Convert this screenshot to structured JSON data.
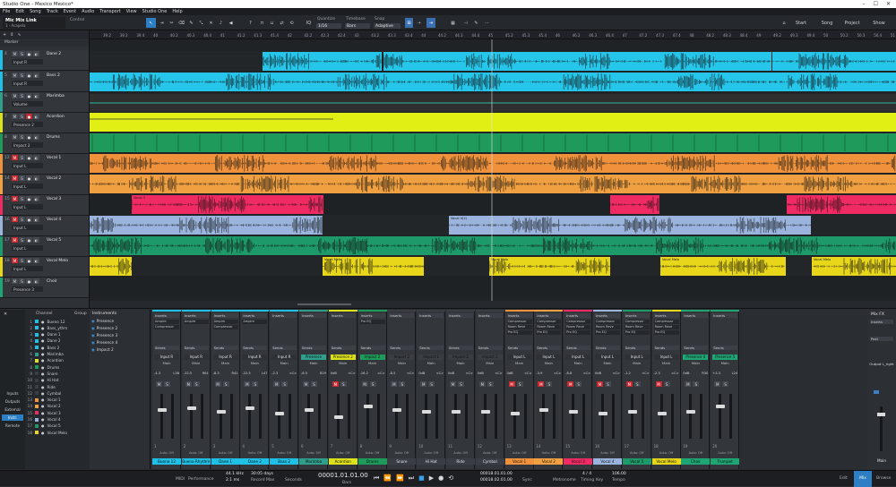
{
  "window": {
    "title": "Studio One - Mexico Mexico*"
  },
  "menu": [
    "File",
    "Edit",
    "Song",
    "Track",
    "Event",
    "Audio",
    "Transport",
    "View",
    "Studio One",
    "Help"
  ],
  "toolbar": {
    "song_name": "Mic Mix Link",
    "preset": "1 - Acapela",
    "control_label": "Control",
    "quantize_label": "Quantize",
    "quantize_value": "1/16",
    "timebase_label": "Timebase",
    "timebase_value": "Bars",
    "snap_label": "Snap",
    "snap_value": "Adaptive",
    "start": "Start",
    "song": "Song",
    "project": "Project",
    "show": "Show"
  },
  "ruler": {
    "marks": [
      "39.2",
      "39.3",
      "39.4",
      "40",
      "40.2",
      "40.3",
      "40.4",
      "41",
      "41.2",
      "41.3",
      "41.4",
      "42",
      "42.2",
      "42.3",
      "42.4",
      "43",
      "43.2",
      "43.3",
      "43.4",
      "44",
      "44.2",
      "44.3",
      "44.4",
      "45",
      "45.2",
      "45.3",
      "45.4",
      "46",
      "46.2",
      "46.3",
      "46.4",
      "47",
      "47.2",
      "47.3",
      "47.4",
      "48",
      "48.2",
      "48.3",
      "48.4",
      "49",
      "49.2",
      "49.3",
      "49.4",
      "50",
      "50.2",
      "50.3",
      "50.4",
      "51"
    ]
  },
  "tracks": [
    {
      "num": "4",
      "name": "Dane 2",
      "input": "Input R",
      "color": "#1ec0e6"
    },
    {
      "num": "5",
      "name": "Bass 2",
      "input": "Input R",
      "color": "#1ec0e6"
    },
    {
      "num": "6",
      "name": "Marimba",
      "input": "Volume",
      "color": "#2f9e8a",
      "value": "-2.5"
    },
    {
      "num": "7",
      "name": "Acordion",
      "input": "Presence 2",
      "color": "#dde11a"
    },
    {
      "num": "8",
      "name": "Drums",
      "input": "Impact 2",
      "color": "#1e9a5a"
    },
    {
      "num": "12",
      "name": "Vocal 1",
      "input": "Input L",
      "color": "#f0923c"
    },
    {
      "num": "14",
      "name": "Vocal 2",
      "input": "Input L",
      "color": "#f0a040"
    },
    {
      "num": "15",
      "name": "Vocal 3",
      "input": "Input L",
      "color": "#f02a62"
    },
    {
      "num": "16",
      "name": "Vocal 4",
      "input": "Input L",
      "color": "#9ab4de"
    },
    {
      "num": "17",
      "name": "Vocal 5",
      "input": "Input L",
      "color": "#1e9a6a"
    },
    {
      "num": "18",
      "name": "Vocal Melo",
      "input": "Input L",
      "color": "#e8d61a"
    },
    {
      "num": "19",
      "name": "Choir",
      "input": "Presence 3",
      "color": "#1ea574"
    }
  ],
  "clip_labels": {
    "vocal3": "Vocal 3",
    "vocal4": "Vocal 4(2)",
    "vocalmelo": "Vocal Melo"
  },
  "track_header_top": {
    "label": "Marker"
  },
  "instruments": {
    "header": "Instruments",
    "items": [
      "Presence",
      "Presence 2",
      "Presence 3",
      "Presence 4",
      "Impact 2"
    ]
  },
  "channel_list": {
    "header_channel": "Channel",
    "header_group": "Group",
    "items": [
      {
        "n": "1",
        "name": "Bueno 12"
      },
      {
        "n": "2",
        "name": "Bass_ythm"
      },
      {
        "n": "3",
        "name": "Dane 1"
      },
      {
        "n": "4",
        "name": "Dane 2"
      },
      {
        "n": "5",
        "name": "Bass 2"
      },
      {
        "n": "6",
        "name": "Marimba"
      },
      {
        "n": "7",
        "name": "Acordion"
      },
      {
        "n": "8",
        "name": "Drums"
      },
      {
        "n": "9",
        "name": "Snare"
      },
      {
        "n": "10",
        "name": "Hi Hat"
      },
      {
        "n": "11",
        "name": "Ride"
      },
      {
        "n": "12",
        "name": "Cymbal"
      },
      {
        "n": "13",
        "name": "Vocal 1"
      },
      {
        "n": "14",
        "name": "Vocal 2"
      },
      {
        "n": "15",
        "name": "Vocal 3"
      },
      {
        "n": "16",
        "name": "Vocal 4"
      },
      {
        "n": "17",
        "name": "Vocal 5"
      },
      {
        "n": "18",
        "name": "Vocal Melo"
      }
    ],
    "side": [
      "Inputs",
      "Outputs",
      "External",
      "Instr.",
      "Remote"
    ]
  },
  "strips": [
    {
      "n": "1",
      "label": "Bueno 12",
      "color": "#1ec0e6",
      "input": "Input R",
      "vals": [
        "-4.3",
        "L38"
      ]
    },
    {
      "n": "2",
      "label": "Bueno Rhythm",
      "color": "#1ec0e6",
      "input": "Input R",
      "vals": [
        "-22.5",
        "R61"
      ]
    },
    {
      "n": "3",
      "label": "Dane 1",
      "color": "#1ec0e6",
      "input": "Input R",
      "vals": [
        "-8.3",
        "R41"
      ]
    },
    {
      "n": "4",
      "label": "Dane 2",
      "color": "#1ec0e6",
      "input": "Input R",
      "vals": [
        "-22.5",
        "L47"
      ]
    },
    {
      "n": "5",
      "label": "Bass 2",
      "color": "#1ec0e6",
      "input": "Input R",
      "vals": [
        "-2.3",
        "<C>"
      ]
    },
    {
      "n": "6",
      "label": "Marimba",
      "color": "#2f9e8a",
      "input": "Presence",
      "vals": [
        "-8.5",
        "R29"
      ]
    },
    {
      "n": "7",
      "label": "Acordion",
      "color": "#dde11a",
      "input": "Presence 2",
      "vals": [
        "0dB",
        "<C>"
      ]
    },
    {
      "n": "8",
      "label": "Drums",
      "color": "#1e9a5a",
      "input": "Impact 2",
      "vals": [
        "-16.2",
        "<C>"
      ]
    },
    {
      "n": "9",
      "label": "Snare",
      "color": "#3a3e44",
      "input": "Impact 2",
      "vals": [
        "-8.5",
        "<C>"
      ]
    },
    {
      "n": "10",
      "label": "Hi Hat",
      "color": "#3a3e44",
      "input": "Impact 2",
      "vals": [
        "0dB",
        "<C>"
      ]
    },
    {
      "n": "11",
      "label": "Ride",
      "color": "#3a3e44",
      "input": "Impact 2",
      "vals": [
        "0dB",
        "<C>"
      ]
    },
    {
      "n": "12",
      "label": "Cymbal",
      "color": "#3a3e44",
      "input": "Impact 2",
      "vals": [
        "0dB",
        "<C>"
      ]
    },
    {
      "n": "13",
      "label": "Vocal 1",
      "color": "#f0923c",
      "input": "Input L",
      "vals": [
        "0dB",
        "<C>"
      ]
    },
    {
      "n": "14",
      "label": "Vocal 2",
      "color": "#f0a040",
      "input": "Input L",
      "vals": [
        "-3.9",
        "<C>"
      ]
    },
    {
      "n": "15",
      "label": "Vocal 3",
      "color": "#f02a62",
      "input": "Input L",
      "vals": [
        "-6.8",
        "<C>"
      ]
    },
    {
      "n": "16",
      "label": "Vocal 4",
      "color": "#9ab4de",
      "input": "Input L",
      "vals": [
        "0dB",
        "<C>"
      ]
    },
    {
      "n": "17",
      "label": "Vocal 5",
      "color": "#1e9a6a",
      "input": "Input L",
      "vals": [
        "-1.2",
        "<C>"
      ]
    },
    {
      "n": "18",
      "label": "Vocal Melo",
      "color": "#e8d61a",
      "input": "Input L",
      "vals": [
        "-2.3",
        "<C>"
      ]
    },
    {
      "n": "19",
      "label": "Choir",
      "color": "#1ea574",
      "input": "Presence 4",
      "vals": [
        "0dB",
        "R30"
      ]
    },
    {
      "n": "20",
      "label": "Trumpet",
      "color": "#1ea574",
      "input": "Presence 5",
      "vals": [
        "+3.3",
        "L24"
      ]
    }
  ],
  "strip_common": {
    "inserts": "Inserts",
    "sends": "Sends",
    "main": "Main",
    "auto": "Auto: Off",
    "m": "M",
    "s": "S"
  },
  "vocal_inserts": [
    "Compressor",
    "Room Reve",
    "Pro EQ"
  ],
  "mixfx": {
    "title": "Mix FX",
    "inserts": "Inserts",
    "post": "Post",
    "output": "Output L_right",
    "main": "Main"
  },
  "transport": {
    "midi": "MIDI",
    "performance": "Performance",
    "sample_rate": "44.1 kHz",
    "latency": "2.1 ms",
    "record_label": "Record Max",
    "days": "30:05 days",
    "seconds": "Seconds",
    "position": "00001.01.01.00",
    "bars": "Bars",
    "loop_start": "00018.01.01.00",
    "loop_end": "00018.02.01.00",
    "sync": "Sync",
    "metronome": "Metronome",
    "timing": "Timing",
    "sig": "4 / 4",
    "key": "Key",
    "tempo": "106.00",
    "tempo_label": "Tempo",
    "edit": "Edit",
    "mix": "Mix",
    "browse": "Browse"
  }
}
